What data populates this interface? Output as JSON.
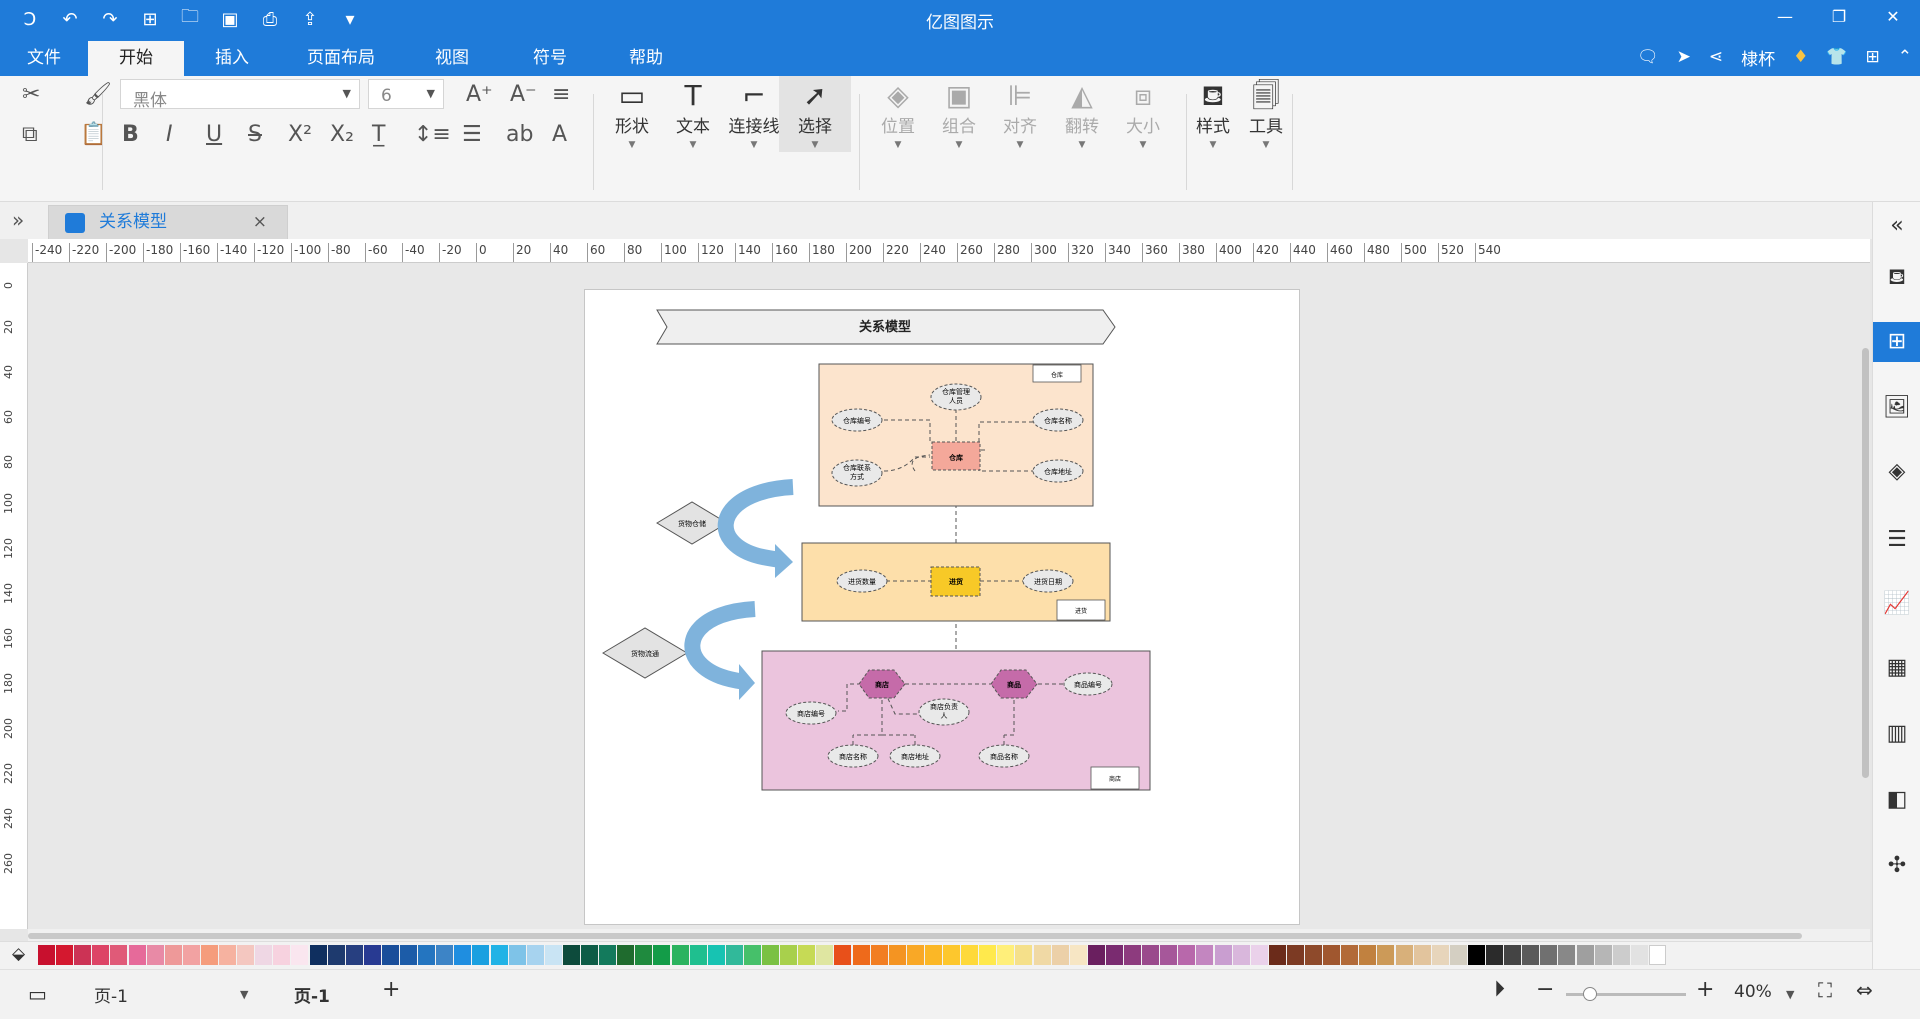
{
  "app": {
    "title": "亿图图示",
    "quick_access": [
      "logo-icon",
      "undo-icon",
      "redo-icon",
      "new-icon",
      "open-icon",
      "save-icon",
      "print-icon",
      "export-icon",
      "customize-icon"
    ]
  },
  "menu": {
    "tabs": [
      "文件",
      "开始",
      "插入",
      "页面布局",
      "视图",
      "符号",
      "帮助"
    ],
    "active": "开始",
    "user_name": "棣杯"
  },
  "ribbon": {
    "font_name": "黑体",
    "font_size": "6",
    "tools": [
      {
        "label": "形状",
        "icon": "shape-rect-icon",
        "enabled": true,
        "selected": false
      },
      {
        "label": "文本",
        "icon": "text-t-icon",
        "enabled": true,
        "selected": false
      },
      {
        "label": "连接线",
        "icon": "connector-icon",
        "enabled": true,
        "selected": false
      },
      {
        "label": "选择",
        "icon": "select-pointer-icon",
        "enabled": true,
        "selected": true
      }
    ],
    "arrange": [
      {
        "label": "位置",
        "icon": "position-icon",
        "enabled": false
      },
      {
        "label": "组合",
        "icon": "group-icon",
        "enabled": false
      },
      {
        "label": "对齐",
        "icon": "align-icon",
        "enabled": false
      },
      {
        "label": "翻转",
        "icon": "flip-icon",
        "enabled": false
      },
      {
        "label": "大小",
        "icon": "size-icon",
        "enabled": false
      }
    ],
    "extra": [
      {
        "label": "样式",
        "icon": "style-bucket-icon"
      },
      {
        "label": "工具",
        "icon": "tools-icon"
      }
    ]
  },
  "document_tab": {
    "title": "关系模型",
    "close": "×"
  },
  "ruler": {
    "h_labels": [
      "-240",
      "-220",
      "-200",
      "-180",
      "-160",
      "-140",
      "-120",
      "-100",
      "-80",
      "-60",
      "-40",
      "-20",
      "0",
      "20",
      "40",
      "60",
      "80",
      "100",
      "120",
      "140",
      "160",
      "180",
      "200",
      "220",
      "240",
      "260",
      "280",
      "300",
      "320",
      "340",
      "360",
      "380",
      "400",
      "420",
      "440",
      "460",
      "480",
      "500",
      "520",
      "540"
    ],
    "v_labels": [
      "0",
      "20",
      "40",
      "60",
      "80",
      "100",
      "120",
      "140",
      "160",
      "180",
      "200",
      "220",
      "240",
      "260"
    ]
  },
  "diagram": {
    "title": "关系模型",
    "groups": {
      "warehouse": {
        "tag": "仓库",
        "fill": "#fce4cd",
        "center": "仓库",
        "attrs": [
          "仓库管理人员",
          "仓库编号",
          "仓库名称",
          "仓库联系方式",
          "仓库地址"
        ]
      },
      "purchase": {
        "tag": "进货",
        "fill": "#fddfaa",
        "center": "进货",
        "attrs": [
          "进货数量",
          "进货日期"
        ]
      },
      "store": {
        "tag": "商店",
        "fill": "#ebc4dd",
        "hex": [
          "商店",
          "商品"
        ],
        "attrs": [
          "商品编号",
          "商店编号",
          "商店负责人",
          "商店名称",
          "商店地址",
          "商品名称"
        ]
      }
    },
    "decisions": [
      "货物仓储",
      "货物流通"
    ]
  },
  "right_panel": [
    {
      "icon": "collapse-left-icon",
      "active": false
    },
    {
      "icon": "fill-bucket-icon",
      "active": false
    },
    {
      "icon": "symbols-grid-icon",
      "active": true
    },
    {
      "icon": "image-icon",
      "active": false
    },
    {
      "icon": "layers-icon",
      "active": false
    },
    {
      "icon": "page-list-icon",
      "active": false
    },
    {
      "icon": "chart-icon",
      "active": false
    },
    {
      "icon": "table-icon",
      "active": false
    },
    {
      "icon": "building-icon",
      "active": false
    },
    {
      "icon": "shadow-icon",
      "active": false
    },
    {
      "icon": "connect-icon",
      "active": false
    }
  ],
  "palette": [
    "#c8102e",
    "#d4182f",
    "#cc3355",
    "#dd4466",
    "#e05a78",
    "#e66a9a",
    "#e88aa6",
    "#ee9999",
    "#f2a2a2",
    "#f59c7c",
    "#f6b2a0",
    "#f4c7c0",
    "#efd7e4",
    "#f7d2df",
    "#fae6ef",
    "#0f2f5f",
    "#1e3a6e",
    "#273f80",
    "#283a92",
    "#1a4e9a",
    "#1c5ca8",
    "#2475c0",
    "#3d84c6",
    "#1f8ee0",
    "#1aa0e0",
    "#21b3e6",
    "#7ec3e8",
    "#a7d3ef",
    "#c9e4f4",
    "#0d4b3c",
    "#0d5c46",
    "#137a5c",
    "#1f6b2e",
    "#1f8a3e",
    "#139c48",
    "#2bb35f",
    "#1fbf8f",
    "#17c3b2",
    "#31b99a",
    "#46c06a",
    "#7ac143",
    "#a8d04c",
    "#c6da55",
    "#dfe6a1",
    "#e8501a",
    "#ee6a1b",
    "#f27e22",
    "#f49422",
    "#f9a826",
    "#fbb726",
    "#fdc72d",
    "#fed93a",
    "#ffe94c",
    "#ffef7a",
    "#f5e08a",
    "#f0d9a5",
    "#ecd0a8",
    "#f7e6c4",
    "#6a1f5f",
    "#7a2b70",
    "#8d3b7e",
    "#9a4a8c",
    "#a6579a",
    "#b868ab",
    "#c386c0",
    "#c99ed0",
    "#d9b7dc",
    "#ead1ea",
    "#6b2b1a",
    "#7c3a23",
    "#8e4a2b",
    "#a0572f",
    "#b26a38",
    "#c1813f",
    "#cc9a58",
    "#d8b07a",
    "#e2c49d",
    "#e7d5bb",
    "#d4cfc2",
    "#000000",
    "#2b2b2b",
    "#444444",
    "#5b5b5b",
    "#707070",
    "#888888",
    "#9f9f9f",
    "#b6b6b6",
    "#cccccc",
    "#e2e2e2",
    "#ffffff"
  ],
  "status": {
    "page_selector": "页-1",
    "page_tab": "页-1",
    "add": "+",
    "zoom_minus": "−",
    "zoom_plus": "+",
    "zoom": "40%",
    "zoom_fraction": 0.2
  }
}
